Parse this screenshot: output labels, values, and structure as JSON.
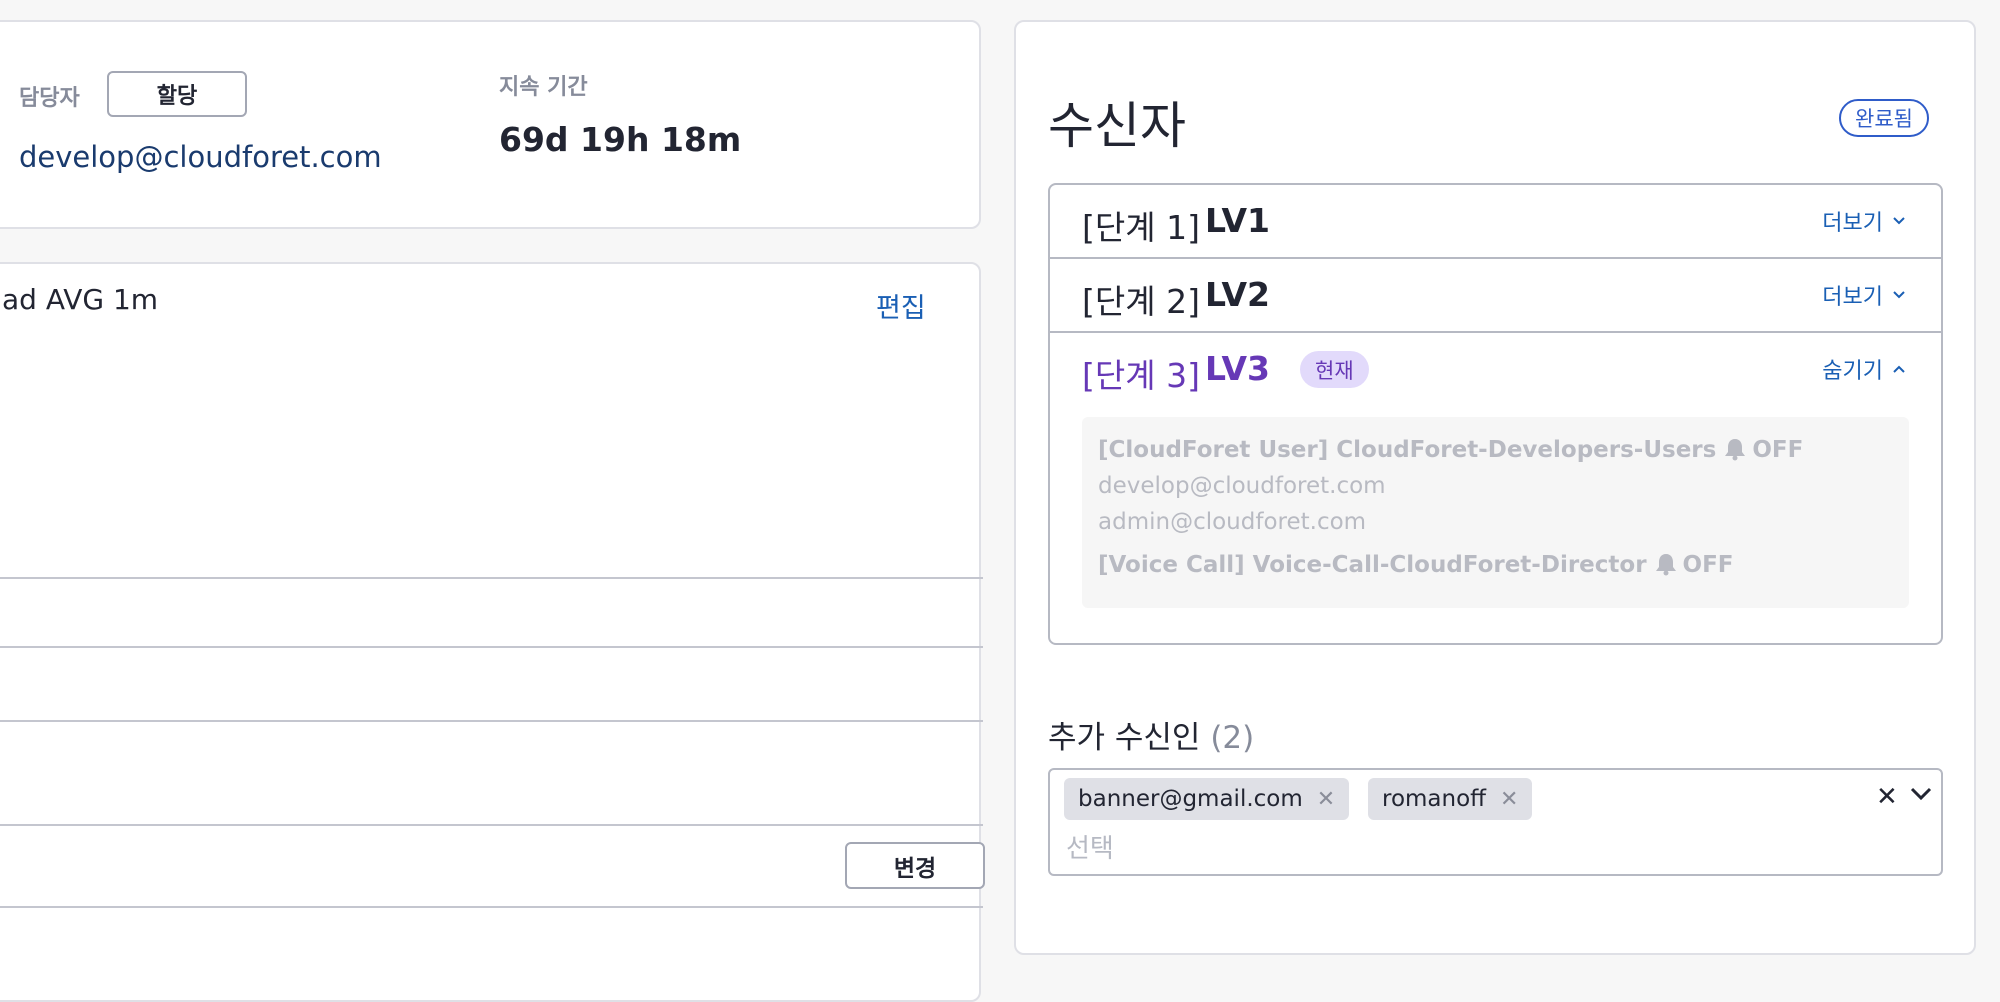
{
  "summary": {
    "assignee_label": "담당자",
    "assign_button": "할당",
    "assignee_email": "develop@cloudforet.com",
    "duration_label": "지속 기간",
    "duration_value": "69d 19h 18m"
  },
  "detail": {
    "description": "ad AVG 1m",
    "edit_label": "편집",
    "change_button": "변경"
  },
  "recipients": {
    "title": "수신자",
    "status_badge": "완료됨",
    "levels": [
      {
        "step": "[단계 1]",
        "name": "LV1",
        "toggle": "더보기"
      },
      {
        "step": "[단계 2]",
        "name": "LV2",
        "toggle": "더보기"
      },
      {
        "step": "[단계 3]",
        "name": "LV3",
        "current_tag": "현재",
        "toggle": "숨기기"
      }
    ],
    "members": {
      "channel1": "[CloudForet User] CloudForet-Developers-Users",
      "channel1_state": "OFF",
      "emails": [
        "develop@cloudforet.com",
        "admin@cloudforet.com"
      ],
      "channel2": "[Voice Call] Voice-Call-CloudForet-Director",
      "channel2_state": "OFF"
    },
    "extra_title": "추가 수신인",
    "extra_count": "(2)",
    "extra_chips": [
      "banner@gmail.com",
      "romanoff"
    ],
    "extra_placeholder": "선택"
  },
  "colors": {
    "accent_blue": "#1a5fb4",
    "current_purple": "#6638b6",
    "badge_blue": "#2f5cc9"
  },
  "icons": [
    "bell-icon",
    "chevron-down-icon",
    "chevron-up-icon",
    "close-icon"
  ]
}
